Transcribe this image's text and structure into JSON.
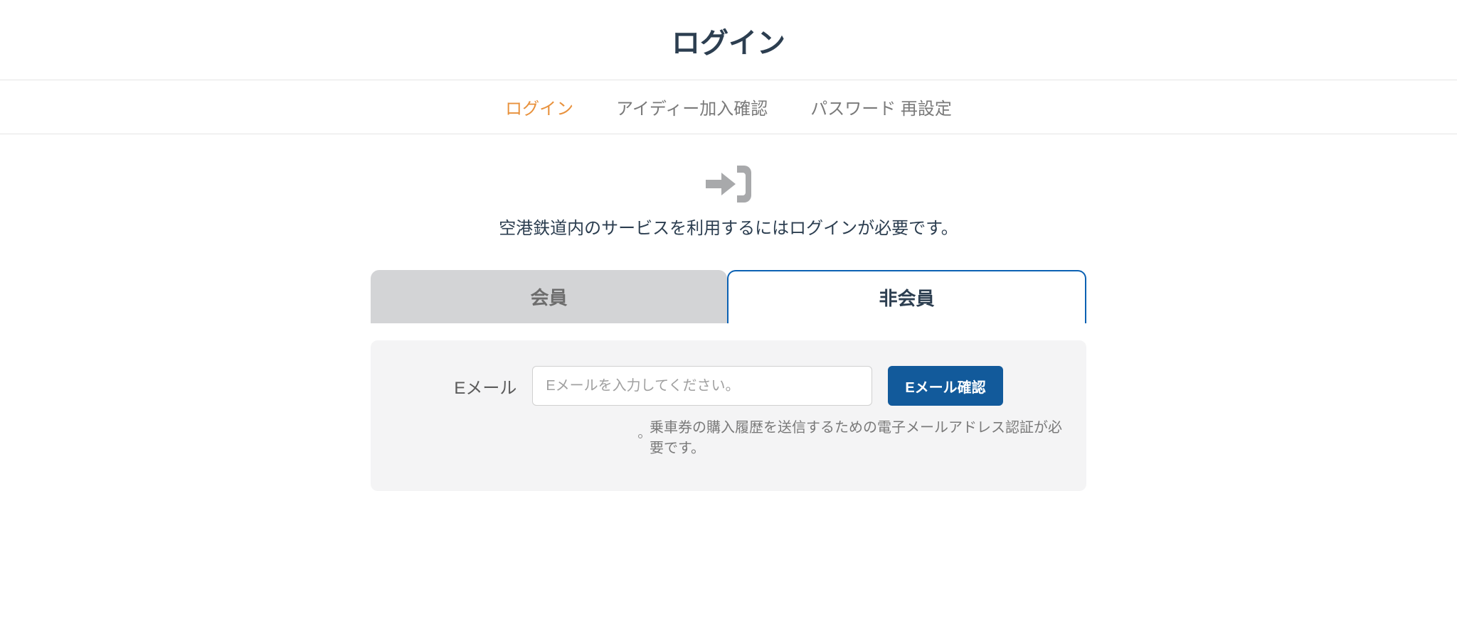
{
  "page": {
    "title": "ログイン"
  },
  "nav": {
    "items": [
      {
        "label": "ログイン",
        "active": true
      },
      {
        "label": "アイディー加入確認",
        "active": false
      },
      {
        "label": "パスワード 再設定",
        "active": false
      }
    ]
  },
  "info": {
    "text": "空港鉄道内のサービスを利用するにはログインが必要です。"
  },
  "tabs": {
    "member": "会員",
    "nonmember": "非会員"
  },
  "form": {
    "email_label": "Eメール",
    "email_placeholder": "Eメールを入力してください。",
    "confirm_button": "Eメール確認",
    "hint": "乗車券の購入履歴を送信するための電子メールアドレス認証が必要です。"
  },
  "icons": {
    "login": "login-arrow"
  }
}
